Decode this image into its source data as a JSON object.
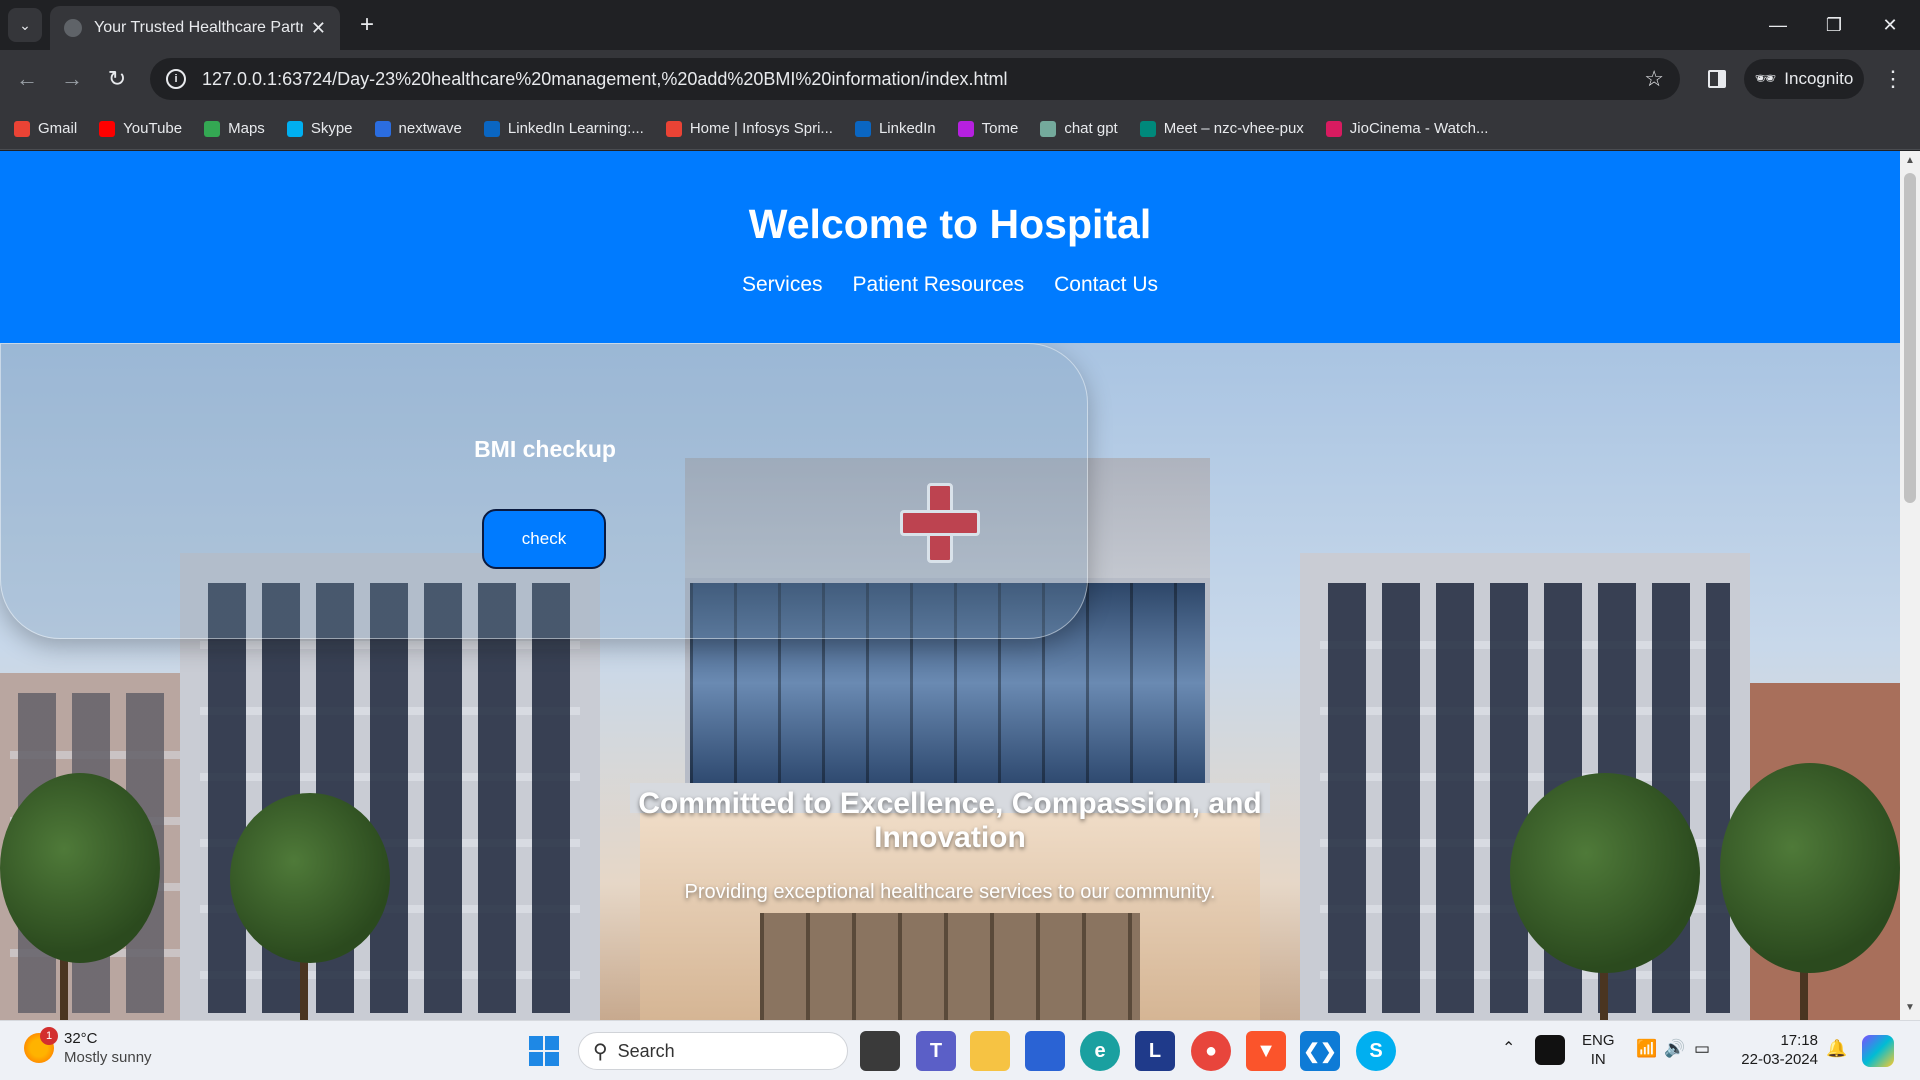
{
  "browser": {
    "tab_title": "Your Trusted Healthcare Partner",
    "url": "127.0.0.1:63724/Day-23%20healthcare%20management,%20add%20BMI%20information/index.html",
    "incognito_label": "Incognito",
    "bookmarks": [
      {
        "label": "Gmail",
        "color": "#ea4335"
      },
      {
        "label": "YouTube",
        "color": "#ff0000"
      },
      {
        "label": "Maps",
        "color": "#34a853"
      },
      {
        "label": "Skype",
        "color": "#00aff0"
      },
      {
        "label": "nextwave",
        "color": "#2b6de0"
      },
      {
        "label": "LinkedIn Learning:...",
        "color": "#0a66c2"
      },
      {
        "label": "Home | Infosys Spri...",
        "color": "#ea4335"
      },
      {
        "label": "LinkedIn",
        "color": "#0a66c2"
      },
      {
        "label": "Tome",
        "color": "#b620e0"
      },
      {
        "label": "chat gpt",
        "color": "#74aa9c"
      },
      {
        "label": "Meet – nzc-vhee-pux",
        "color": "#00897b"
      },
      {
        "label": "JioCinema - Watch...",
        "color": "#d81b60"
      }
    ]
  },
  "site": {
    "title": "Welcome to Hospital",
    "nav": [
      "Services",
      "Patient Resources",
      "Contact Us"
    ],
    "bmi": {
      "heading": "BMI checkup",
      "button": "check"
    },
    "hero": {
      "headline": "Committed to Excellence, Compassion, and Innovation",
      "subline": "Providing exceptional healthcare services to our community."
    },
    "colors": {
      "primary": "#007bff"
    }
  },
  "taskbar": {
    "weather": {
      "temp": "32°C",
      "condition": "Mostly sunny",
      "badge": "1"
    },
    "search_placeholder": "Search",
    "lang": {
      "line1": "ENG",
      "line2": "IN"
    },
    "clock": {
      "time": "17:18",
      "date": "22-03-2024"
    }
  }
}
